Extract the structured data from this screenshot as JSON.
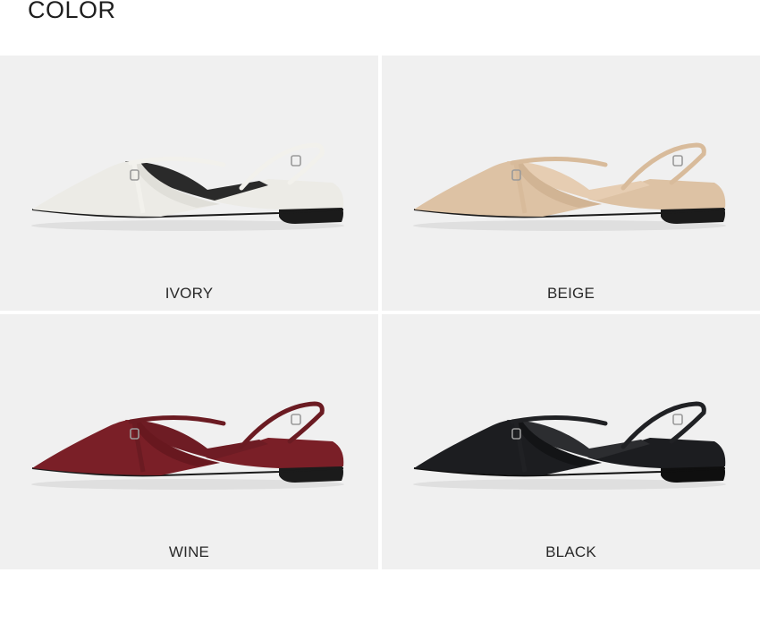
{
  "section_heading": "COLOR",
  "colors": [
    {
      "label": "IVORY",
      "shoe": "#ecebe6",
      "shade": "#d9d7d0",
      "lining": "#2a2a2a",
      "sole": "#1b1b1b",
      "strap": "#f2f1ec"
    },
    {
      "label": "BEIGE",
      "shoe": "#ddc2a4",
      "shade": "#c9aa8a",
      "lining": "#e6cdb2",
      "sole": "#1b1b1b",
      "strap": "#d8bb9b"
    },
    {
      "label": "WINE",
      "shoe": "#7a1f27",
      "shade": "#5c141b",
      "lining": "#6e1c24",
      "sole": "#1b1b1b",
      "strap": "#6b1b22"
    },
    {
      "label": "BLACK",
      "shoe": "#1c1d20",
      "shade": "#0e0f11",
      "lining": "#2c2d30",
      "sole": "#0f0f0f",
      "strap": "#202124"
    }
  ]
}
